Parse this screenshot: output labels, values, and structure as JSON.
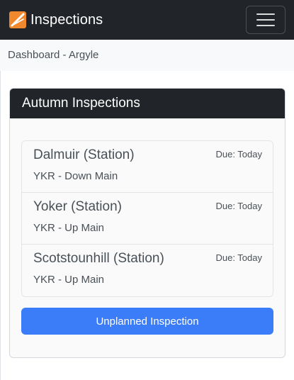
{
  "app": {
    "title": "Inspections",
    "logo_icon": "logo-icon",
    "menu_icon": "hamburger-menu-icon"
  },
  "breadcrumb": "Dashboard - Argyle",
  "card": {
    "title": "Autumn Inspections",
    "items": [
      {
        "title": "Dalmuir (Station)",
        "subtitle": "YKR - Down Main",
        "due": "Due: Today"
      },
      {
        "title": "Yoker (Station)",
        "subtitle": "YKR - Up Main",
        "due": "Due: Today"
      },
      {
        "title": "Scotstounhill (Station)",
        "subtitle": "YKR - Up Main",
        "due": "Due: Today"
      }
    ],
    "button_label": "Unplanned Inspection"
  },
  "colors": {
    "navbar": "#212529",
    "accent": "#3b7df8",
    "logo_orange": "#f0892e"
  }
}
